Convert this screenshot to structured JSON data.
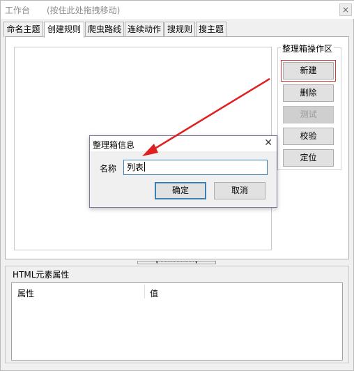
{
  "window": {
    "title": "工作台",
    "title_hint": "(按住此处拖拽移动)",
    "close_label": "×"
  },
  "tabs": [
    {
      "label": "命名主题",
      "active": false
    },
    {
      "label": "创建规则",
      "active": true
    },
    {
      "label": "爬虫路线",
      "active": false
    },
    {
      "label": "连续动作",
      "active": false
    },
    {
      "label": "搜规则",
      "active": false
    },
    {
      "label": "搜主题",
      "active": false
    }
  ],
  "operations": {
    "group_label": "整理箱操作区",
    "buttons": [
      {
        "label": "新建",
        "disabled": false
      },
      {
        "label": "删除",
        "disabled": false
      },
      {
        "label": "测试",
        "disabled": true
      },
      {
        "label": "校验",
        "disabled": false
      },
      {
        "label": "定位",
        "disabled": false
      }
    ]
  },
  "splitter": {
    "label": "▾ ·························· ▾"
  },
  "properties": {
    "header": "HTML元素属性",
    "columns": [
      "属性",
      "值"
    ]
  },
  "dialog": {
    "title": "整理箱信息",
    "close_label": "✕",
    "name_label": "名称",
    "name_value": "列表",
    "ok_label": "确定",
    "cancel_label": "取消"
  },
  "colors": {
    "arrow": "#e02020",
    "highlight_border": "#d23a3a",
    "input_border": "#3c7fb1"
  }
}
